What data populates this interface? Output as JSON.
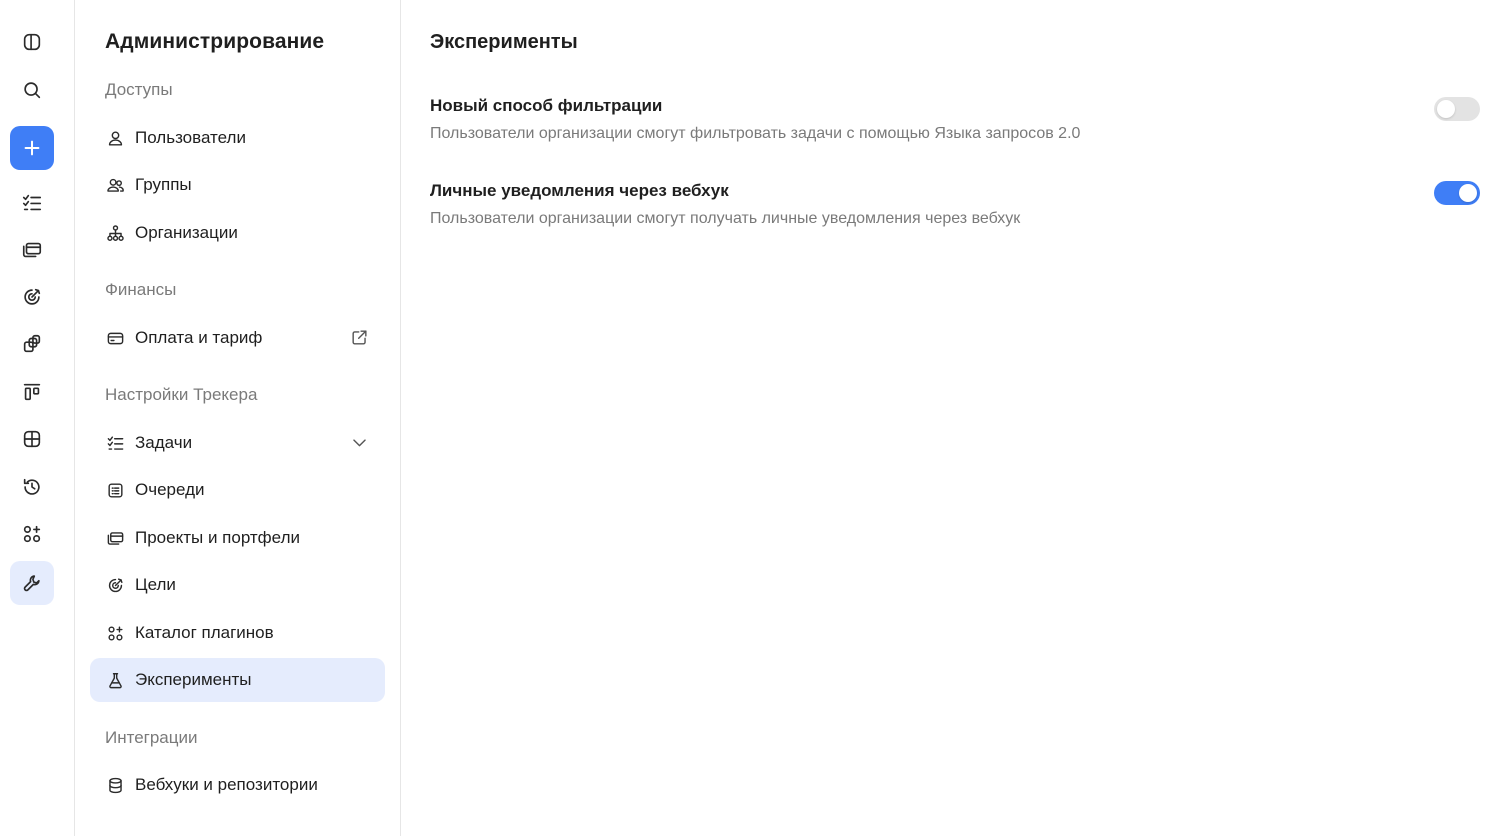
{
  "colors": {
    "accent": "#3f7ef6",
    "active_bg": "#e5ecfd",
    "muted_text": "#7a7a7a",
    "toggle_off": "#e3e3e3"
  },
  "rail": {
    "items": [
      {
        "icon": "sidebar-toggle-icon"
      },
      {
        "icon": "search-icon"
      },
      {
        "icon": "plus-icon"
      },
      {
        "icon": "task-list-icon"
      },
      {
        "icon": "projects-icon"
      },
      {
        "icon": "goals-icon"
      },
      {
        "icon": "portfolio-icon"
      },
      {
        "icon": "board-icon"
      },
      {
        "icon": "table-icon"
      },
      {
        "icon": "history-icon"
      },
      {
        "icon": "plugins-icon"
      },
      {
        "icon": "wrench-icon"
      }
    ]
  },
  "sidebar": {
    "title": "Администрирование",
    "sections": {
      "access": "Доступы",
      "finance": "Финансы",
      "tracker": "Настройки Трекера",
      "integrations": "Интеграции"
    },
    "items": {
      "users": "Пользователи",
      "groups": "Группы",
      "organizations": "Организации",
      "billing": "Оплата и тариф",
      "tasks": "Задачи",
      "queues": "Очереди",
      "projects": "Проекты и портфели",
      "goals": "Цели",
      "plugins": "Каталог плагинов",
      "experiments": "Эксперименты",
      "webhooks": "Вебхуки и репозитории"
    }
  },
  "main": {
    "title": "Эксперименты",
    "settings": [
      {
        "title": "Новый способ фильтрации",
        "description": "Пользователи организации смогут фильтровать задачи с помощью Языка запросов 2.0",
        "enabled": false
      },
      {
        "title": "Личные уведомления через вебхук",
        "description": "Пользователи организации смогут получать личные уведомления через вебхук",
        "enabled": true
      }
    ]
  }
}
